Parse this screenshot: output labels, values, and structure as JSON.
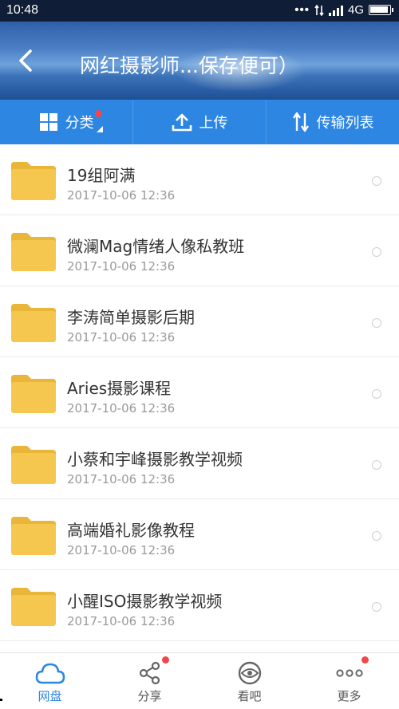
{
  "status_bar": {
    "time": "10:48",
    "network": "4G"
  },
  "header": {
    "title": "网红摄影师...保存便可）"
  },
  "toolbar": {
    "items": [
      {
        "label": "分类",
        "icon": "grid-icon"
      },
      {
        "label": "上传",
        "icon": "upload-icon"
      },
      {
        "label": "传输列表",
        "icon": "transfer-icon"
      }
    ]
  },
  "files": [
    {
      "name": "19组阿满",
      "date": "2017-10-06  12:36"
    },
    {
      "name": "微澜Mag情绪人像私教班",
      "date": "2017-10-06  12:36"
    },
    {
      "name": "李涛简单摄影后期",
      "date": "2017-10-06  12:36"
    },
    {
      "name": "Aries摄影课程",
      "date": "2017-10-06  12:36"
    },
    {
      "name": "小蔡和宇峰摄影教学视频",
      "date": "2017-10-06  12:36"
    },
    {
      "name": "高端婚礼影像教程",
      "date": "2017-10-06  12:36"
    },
    {
      "name": "小醒ISO摄影教学视频",
      "date": "2017-10-06  12:36"
    }
  ],
  "bottom_nav": {
    "items": [
      {
        "label": "网盘",
        "icon": "cloud-icon",
        "active": true
      },
      {
        "label": "分享",
        "icon": "share-icon"
      },
      {
        "label": "看吧",
        "icon": "eye-icon"
      },
      {
        "label": "更多",
        "icon": "more-icon"
      }
    ]
  },
  "colors": {
    "accent": "#2e86e3",
    "badge": "#f04848",
    "folder": "#f5c34a"
  }
}
